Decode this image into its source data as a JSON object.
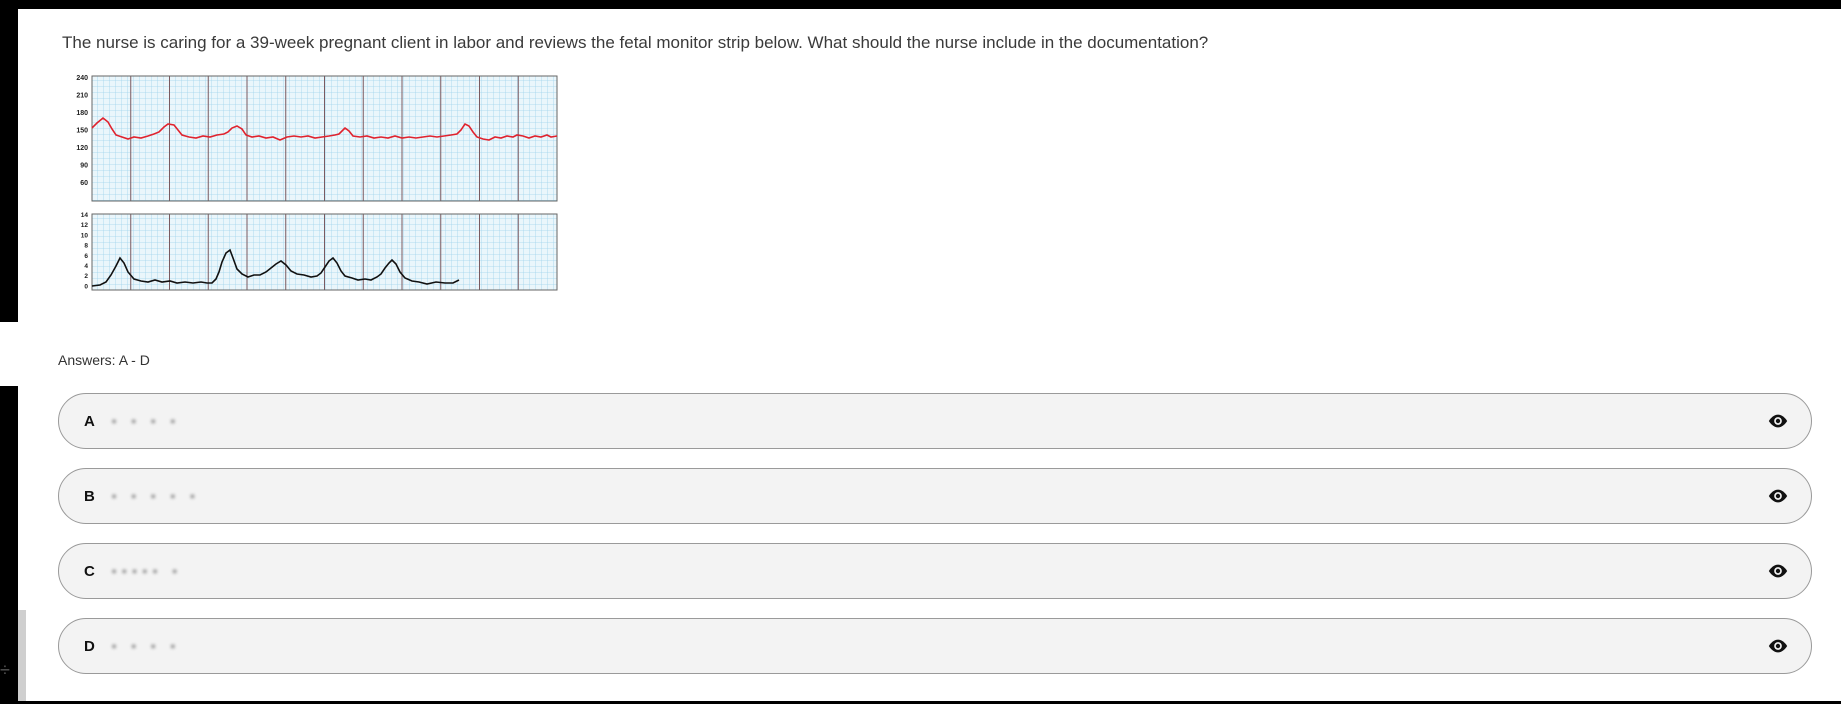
{
  "question": {
    "text": "The nurse is caring for a 39-week pregnant client in labor and reviews the fetal monitor strip below. What should the nurse include in the documentation?"
  },
  "sidebar": {
    "toggle_glyph": "÷"
  },
  "monitor_strip": {
    "fhr_ticks": [
      "240",
      "210",
      "180",
      "150",
      "120",
      "90",
      "60"
    ],
    "uc_ticks": [
      "14",
      "12",
      "10",
      "8",
      "6",
      "4",
      "2",
      "0"
    ]
  },
  "answers": {
    "label": "Answers: A - D",
    "options": [
      {
        "letter": "A",
        "text": "▪ ▪ ▪ ▪",
        "icon": "eye-icon"
      },
      {
        "letter": "B",
        "text": "▪ ▪ ▪ ▪ ▪",
        "icon": "eye-icon"
      },
      {
        "letter": "C",
        "text": "▪▪▪▪▪ ▪",
        "icon": "eye-icon"
      },
      {
        "letter": "D",
        "text": "▪ ▪ ▪ ▪",
        "icon": "eye-icon"
      }
    ]
  },
  "colors": {
    "fhr_trace": "#e0232e",
    "uc_trace": "#111111",
    "grid_minor": "#9fd4ec",
    "grid_major": "#7a5a60",
    "option_bg": "#f3f3f3"
  }
}
